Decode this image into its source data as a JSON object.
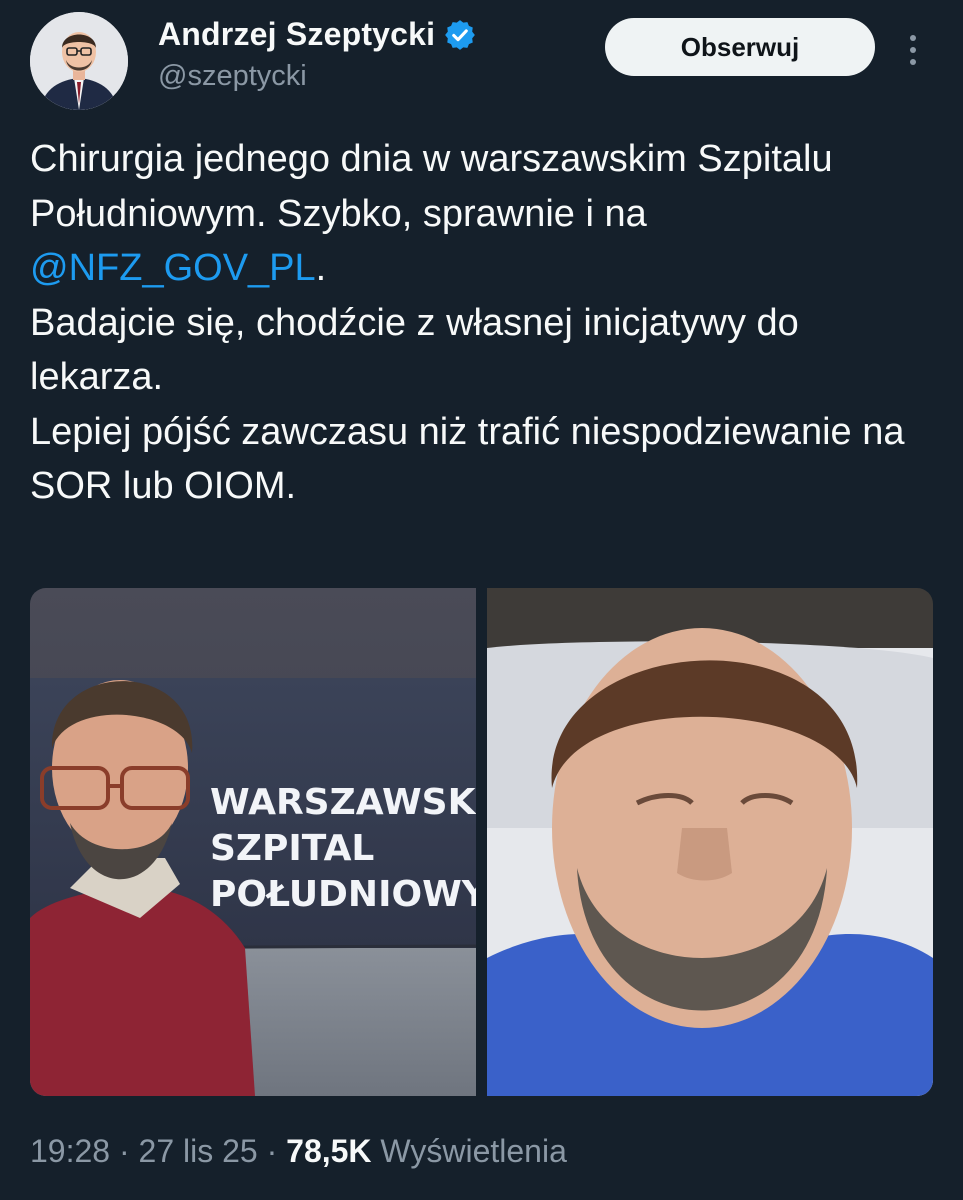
{
  "author": {
    "name": "Andrzej Szeptycki",
    "handle": "@szeptycki",
    "verified": true
  },
  "actions": {
    "follow_label": "Obserwuj",
    "more_icon": "more-vertical-icon"
  },
  "tweet": {
    "line1_a": "Chirurgia jednego dnia w warszawskim Szpitalu Południowym. Szybko, sprawnie i na ",
    "mention": "@NFZ_GOV_PL",
    "line1_b": ".",
    "line2": "Badajcie się, chodźcie z własnej inicjatywy do lekarza.",
    "line3": "Lepiej pójść zawczasu niż trafić niespodziewanie na SOR lub OIOM."
  },
  "media": {
    "left_sign_lines": [
      "WARSZAWSKI",
      "SZPITAL",
      "POŁUDNIOWY"
    ]
  },
  "meta": {
    "time": "19:28",
    "sep": " · ",
    "date": "27 lis 25",
    "views_count": "78,5K",
    "views_label": "Wyświetlenia"
  },
  "colors": {
    "background": "#15202b",
    "link": "#1d9bf0",
    "secondary_text": "#8b98a5"
  }
}
